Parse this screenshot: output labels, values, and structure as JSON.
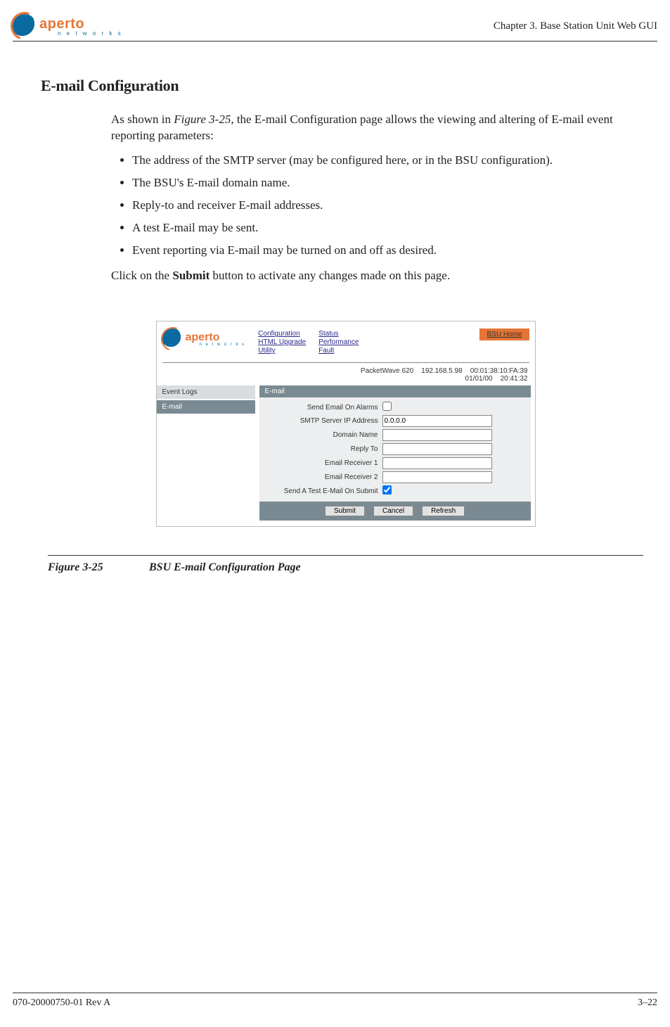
{
  "header": {
    "logo_main": "aperto",
    "logo_sub": "n e t w o r k s",
    "chapter": "Chapter 3.  Base Station Unit Web GUI"
  },
  "section_title": "E-mail Configuration",
  "intro_1": "As shown in ",
  "intro_figref": "Figure 3-25",
  "intro_2": ", the E-mail Configuration page allows the viewing and altering of E-mail event reporting parameters:",
  "bullets": [
    "The address of the SMTP server (may be configured here, or in the BSU configuration).",
    "The BSU's E-mail domain name.",
    "Reply-to and receiver E-mail addresses.",
    "A test E-mail may be sent.",
    "Event reporting via E-mail may be turned on and off as desired."
  ],
  "post_1": "Click on the ",
  "post_bold": "Submit",
  "post_2": " button to activate any changes made on this page.",
  "screenshot": {
    "logo_main": "aperto",
    "logo_sub": "n e t w o r k s",
    "nav_col1": [
      "Configuration",
      "HTML Upgrade",
      "Utility"
    ],
    "nav_col2": [
      "Status",
      "Performance",
      "Fault"
    ],
    "bsu_home": "BSU Home",
    "status_line1": "PacketWave 620    192.168.5.98    00:01:38:10:FA:39",
    "status_line2": "01/01/00    20:41:32",
    "side": {
      "item1": "Event Logs",
      "item2": "E-mail"
    },
    "panel_title": "E-mail",
    "fields": {
      "send_alarms_label": "Send Email On Alarms",
      "smtp_label": "SMTP Server IP Address",
      "smtp_value": "0.0.0.0",
      "domain_label": "Domain Name",
      "domain_value": "",
      "reply_label": "Reply To",
      "reply_value": "",
      "rcv1_label": "Email Receiver 1",
      "rcv1_value": "",
      "rcv2_label": "Email Receiver 2",
      "rcv2_value": "",
      "test_label": "Send A Test E-Mail On Submit"
    },
    "buttons": {
      "submit": "Submit",
      "cancel": "Cancel",
      "refresh": "Refresh"
    }
  },
  "figure": {
    "num": "Figure 3-25",
    "title": "BSU E-mail Configuration Page"
  },
  "footer": {
    "left": "070-20000750-01 Rev A",
    "right": "3–22"
  }
}
